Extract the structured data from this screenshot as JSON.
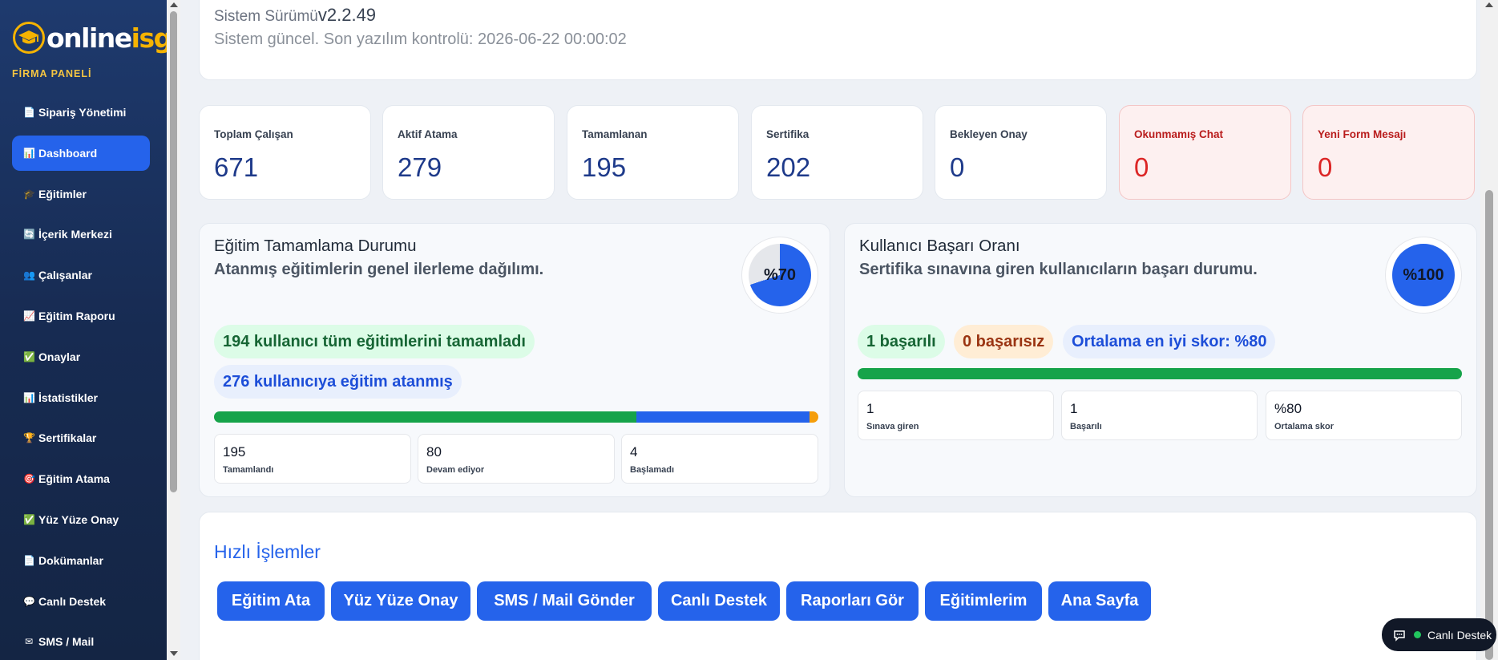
{
  "brand": {
    "logo_text_main": "online",
    "logo_text_accent": "isg",
    "panel_label": "FİRMA PANELİ"
  },
  "sidebar": {
    "items": [
      {
        "icon": "📄",
        "icon_name": "document-icon",
        "label": "Sipariş Yönetimi",
        "active": false
      },
      {
        "icon": "📊",
        "icon_name": "bar-chart-icon",
        "label": "Dashboard",
        "active": true
      },
      {
        "icon": "🎓",
        "icon_name": "graduation-cap-icon",
        "label": "Eğitimler",
        "active": false
      },
      {
        "icon": "🔄",
        "icon_name": "refresh-icon",
        "label": "İçerik Merkezi",
        "active": false
      },
      {
        "icon": "👥",
        "icon_name": "users-icon",
        "label": "Çalışanlar",
        "active": false
      },
      {
        "icon": "📈",
        "icon_name": "trend-chart-icon",
        "label": "Eğitim Raporu",
        "active": false
      },
      {
        "icon": "✅",
        "icon_name": "check-icon",
        "label": "Onaylar",
        "active": false
      },
      {
        "icon": "📊",
        "icon_name": "bar-chart-icon",
        "label": "İstatistikler",
        "active": false
      },
      {
        "icon": "🏆",
        "icon_name": "trophy-icon",
        "label": "Sertifikalar",
        "active": false
      },
      {
        "icon": "🎯",
        "icon_name": "target-icon",
        "label": "Eğitim Atama",
        "active": false
      },
      {
        "icon": "✅",
        "icon_name": "check-icon",
        "label": "Yüz Yüze Onay",
        "active": false
      },
      {
        "icon": "📄",
        "icon_name": "document-icon",
        "label": "Dokümanlar",
        "active": false
      },
      {
        "icon": "💬",
        "icon_name": "chat-bubble-icon",
        "label": "Canlı Destek",
        "active": false
      },
      {
        "icon": "✉",
        "icon_name": "mail-icon",
        "label": "SMS / Mail",
        "active": false
      }
    ]
  },
  "version": {
    "label": "Sistem Sürümü",
    "value": "v2.2.49",
    "status": "Sistem güncel. Son yazılım kontrolü: 2026-06-22 00:00:02"
  },
  "stats": [
    {
      "label": "Toplam Çalışan",
      "value": "671",
      "alert": false
    },
    {
      "label": "Aktif Atama",
      "value": "279",
      "alert": false
    },
    {
      "label": "Tamamlanan",
      "value": "195",
      "alert": false
    },
    {
      "label": "Sertifika",
      "value": "202",
      "alert": false
    },
    {
      "label": "Bekleyen Onay",
      "value": "0",
      "alert": false
    },
    {
      "label": "Okunmamış Chat",
      "value": "0",
      "alert": true
    },
    {
      "label": "Yeni Form Mesajı",
      "value": "0",
      "alert": true
    }
  ],
  "training": {
    "title": "Eğitim Tamamlama Durumu",
    "subtitle": "Atanmış eğitimlerin genel ilerleme dağılımı.",
    "donut_label": "%70",
    "donut_fraction": 0.7,
    "pill_completed": "194 kullanıcı tüm eğitimlerini tamamladı",
    "pill_assigned": "276 kullanıcıya eğitim atanmış",
    "progress": {
      "completed": 195,
      "in_progress": 80,
      "not_started": 4
    },
    "minis": [
      {
        "value": "195",
        "label": "Tamamlandı"
      },
      {
        "value": "80",
        "label": "Devam ediyor"
      },
      {
        "value": "4",
        "label": "Başlamadı"
      }
    ]
  },
  "success": {
    "title": "Kullanıcı Başarı Oranı",
    "subtitle": "Sertifika sınavına giren kullanıcıların başarı durumu.",
    "donut_label": "%100",
    "donut_fraction": 1.0,
    "pill_success": "1 başarılı",
    "pill_fail": "0 başarısız",
    "pill_score": "Ortalama en iyi skor: %80",
    "bar_fraction": 1.0,
    "minis": [
      {
        "value": "1",
        "label": "Sınava giren"
      },
      {
        "value": "1",
        "label": "Başarılı"
      },
      {
        "value": "%80",
        "label": "Ortalama skor"
      }
    ]
  },
  "quick": {
    "title": "Hızlı İşlemler",
    "buttons": [
      "Eğitim Ata",
      "Yüz Yüze Onay",
      "SMS / Mail Gönder",
      "Canlı Destek",
      "Raporları Gör",
      "Eğitimlerim",
      "Ana Sayfa"
    ]
  },
  "live_support": {
    "label": "Canlı Destek"
  },
  "colors": {
    "accent": "#2563eb",
    "success": "#16a34a",
    "warning": "#f59e0b",
    "sidebar": "#1e3a6e",
    "brand_gold": "#f5b301"
  }
}
